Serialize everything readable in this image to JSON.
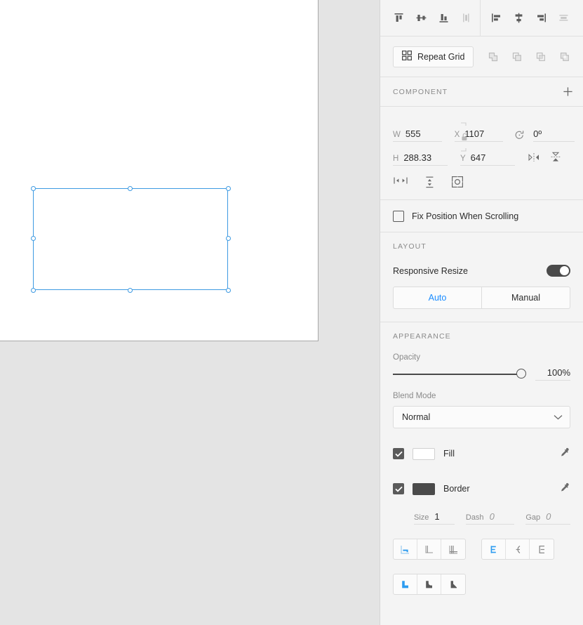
{
  "canvas": {
    "artboard_background": "#ffffff",
    "workspace_background": "#e4e4e4",
    "selection": {
      "name": "selected-rectangle",
      "accent_color": "#3d9ae2",
      "handle_count": 8
    }
  },
  "panel": {
    "align": {
      "vertical": [
        {
          "name": "align-top-icon",
          "label": "Align Top"
        },
        {
          "name": "align-vertical-center-icon",
          "label": "Align Vertical Center"
        },
        {
          "name": "align-bottom-icon",
          "label": "Align Bottom"
        },
        {
          "name": "distribute-vertical-icon",
          "label": "Distribute Vertically"
        }
      ],
      "horizontal": [
        {
          "name": "align-left-icon",
          "label": "Align Left"
        },
        {
          "name": "align-horizontal-center-icon",
          "label": "Align Horizontal Center"
        },
        {
          "name": "align-right-icon",
          "label": "Align Right"
        },
        {
          "name": "distribute-horizontal-icon",
          "label": "Distribute Horizontally"
        }
      ]
    },
    "repeat_grid": {
      "label": "Repeat Grid",
      "icon": "grid-icon"
    },
    "boolean_ops": [
      {
        "name": "boolean-add-icon",
        "label": "Add"
      },
      {
        "name": "boolean-subtract-icon",
        "label": "Subtract"
      },
      {
        "name": "boolean-intersect-icon",
        "label": "Intersect"
      },
      {
        "name": "boolean-exclude-icon",
        "label": "Exclude Overlap"
      }
    ],
    "component": {
      "title": "COMPONENT",
      "add_icon": "plus-icon"
    },
    "transform": {
      "width": {
        "label": "W",
        "value": "555"
      },
      "height": {
        "label": "H",
        "value": "288.33"
      },
      "x": {
        "label": "X",
        "value": "1107"
      },
      "y": {
        "label": "Y",
        "value": "647"
      },
      "rotation": {
        "icon": "rotate-icon",
        "value": "0º"
      },
      "link_lock": {
        "icon": "unlock-icon",
        "state": "unlocked"
      },
      "flip_horizontal": "flip-horizontal-icon",
      "flip_vertical": "flip-vertical-icon",
      "resize_icons": [
        {
          "name": "resize-width-icon",
          "label": "Resize Width"
        },
        {
          "name": "resize-height-icon",
          "label": "Resize Height"
        },
        {
          "name": "resize-fit-icon",
          "label": "Resize To Fit"
        }
      ]
    },
    "fix_position": {
      "label": "Fix Position When Scrolling",
      "checked": false
    },
    "layout": {
      "title": "LAYOUT",
      "responsive_resize": {
        "label": "Responsive Resize",
        "enabled": true
      },
      "mode": {
        "options": [
          "Auto",
          "Manual"
        ],
        "selected": "Auto",
        "selected_color": "#1a8cff"
      }
    },
    "appearance": {
      "title": "APPEARANCE",
      "opacity": {
        "label": "Opacity",
        "value": "100%",
        "percent": 100
      },
      "blend_mode": {
        "label": "Blend Mode",
        "value": "Normal",
        "chevron": "chevron-down-icon"
      },
      "fill": {
        "label": "Fill",
        "checked": true,
        "color": "#ffffff",
        "eyedropper": "eyedropper-icon"
      },
      "border": {
        "label": "Border",
        "checked": true,
        "color": "#4a4a4a",
        "eyedropper": "eyedropper-icon",
        "size": {
          "label": "Size",
          "value": "1",
          "placeholder": false
        },
        "dash": {
          "label": "Dash",
          "value": "0",
          "placeholder": true
        },
        "gap": {
          "label": "Gap",
          "value": "0",
          "placeholder": true
        }
      },
      "stroke_position": [
        {
          "name": "stroke-inside-icon",
          "label": "Inside Stroke",
          "selected": true
        },
        {
          "name": "stroke-center-icon",
          "label": "Center Stroke",
          "selected": false
        },
        {
          "name": "stroke-outside-icon",
          "label": "Outside Stroke",
          "selected": false
        }
      ],
      "line_cap": [
        {
          "name": "cap-butt-icon",
          "label": "Butt Cap",
          "selected": true
        },
        {
          "name": "cap-round-icon",
          "label": "Round Cap",
          "selected": false
        },
        {
          "name": "cap-square-icon",
          "label": "Projecting Cap",
          "selected": false
        }
      ],
      "line_join": [
        {
          "name": "join-miter-icon",
          "label": "Miter Join",
          "selected": true
        },
        {
          "name": "join-round-icon",
          "label": "Round Join",
          "selected": false
        },
        {
          "name": "join-bevel-icon",
          "label": "Bevel Join",
          "selected": false
        }
      ]
    }
  }
}
